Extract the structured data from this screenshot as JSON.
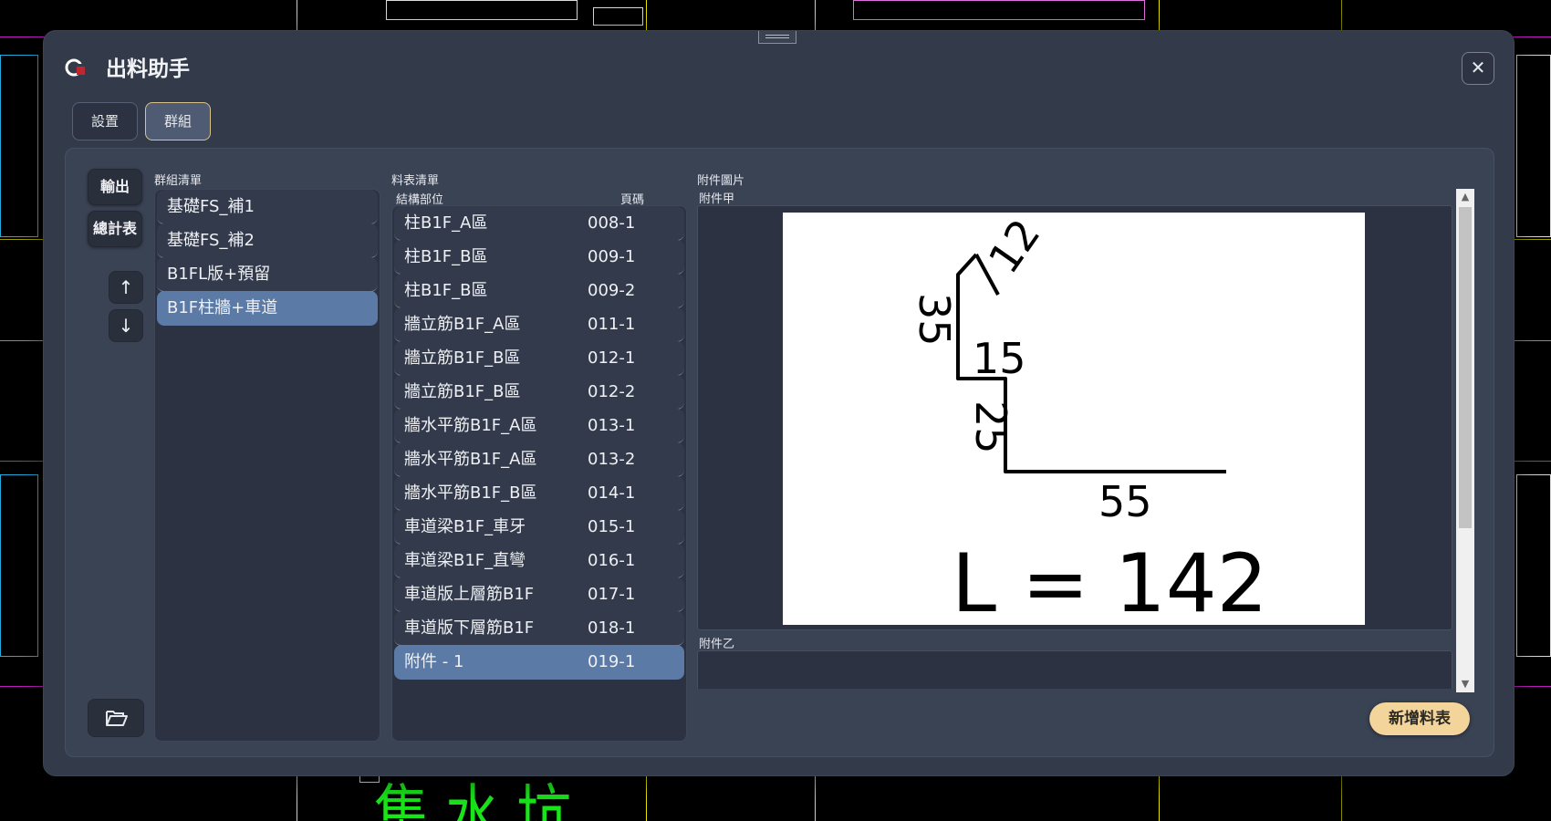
{
  "window": {
    "title": "出料助手",
    "close_label": "✕"
  },
  "tabs": [
    {
      "label": "設置"
    },
    {
      "label": "群組"
    }
  ],
  "sidebar": {
    "export_label": "輸出",
    "summary_label": "總計表",
    "up_label": "↑",
    "down_label": "↓"
  },
  "group_list": {
    "title": "群組清單",
    "items": [
      "基礎FS_補1",
      "基礎FS_補2",
      "B1FL版+預留",
      "B1F柱牆+車道"
    ],
    "selected_index": 3
  },
  "material_list": {
    "title": "料表清單",
    "col_part": "結構部位",
    "col_page": "頁碼",
    "rows": [
      {
        "part": "柱B1F_A區",
        "page": "008-1"
      },
      {
        "part": "柱B1F_B區",
        "page": "009-1"
      },
      {
        "part": "柱B1F_B區",
        "page": "009-2"
      },
      {
        "part": "牆立筋B1F_A區",
        "page": "011-1"
      },
      {
        "part": "牆立筋B1F_B區",
        "page": "012-1"
      },
      {
        "part": "牆立筋B1F_B區",
        "page": "012-2"
      },
      {
        "part": "牆水平筋B1F_A區",
        "page": "013-1"
      },
      {
        "part": "牆水平筋B1F_A區",
        "page": "013-2"
      },
      {
        "part": "牆水平筋B1F_B區",
        "page": "014-1"
      },
      {
        "part": "車道梁B1F_車牙",
        "page": "015-1"
      },
      {
        "part": "車道梁B1F_直彎",
        "page": "016-1"
      },
      {
        "part": "車道版上層筋B1F",
        "page": "017-1"
      },
      {
        "part": "車道版下層筋B1F",
        "page": "018-1"
      },
      {
        "part": "附件 - 1",
        "page": "019-1"
      }
    ],
    "selected_index": 13
  },
  "attachments": {
    "title": "附件圖片",
    "a_label": "附件甲",
    "b_label": "附件乙",
    "drawing": {
      "dim_top": "12",
      "dim_left": "35",
      "dim_mid": "15",
      "dim_lower": "25",
      "dim_bottom": "55",
      "length_label": "L = 142"
    }
  },
  "add_button_label": "新增料表",
  "cad_text": "集水坑",
  "colors": {
    "accent_gold": "#f3d49a",
    "selected_blue": "#5b7aa6",
    "cad_green": "#19e619"
  }
}
